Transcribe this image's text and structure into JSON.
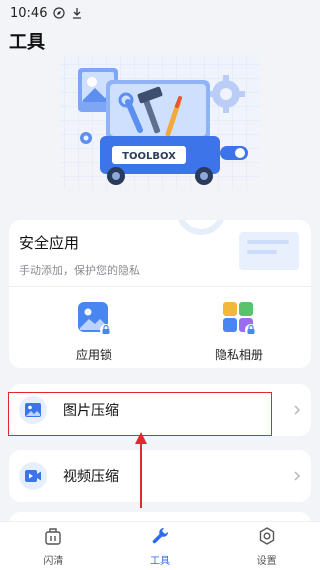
{
  "status_bar": {
    "time": "10:46",
    "icons": [
      "compass-icon",
      "download-icon"
    ]
  },
  "header": {
    "title": "工具"
  },
  "hero": {
    "banner_text": "TOOLBOX",
    "icon": "toolbox-illustration"
  },
  "security_card": {
    "title": "安全应用",
    "subtitle": "手动添加，保护您的隐私",
    "apps": [
      {
        "label": "应用锁",
        "icon": "app-lock-icon"
      },
      {
        "label": "隐私相册",
        "icon": "private-album-icon"
      }
    ]
  },
  "tools": [
    {
      "label": "图片压缩",
      "icon": "image-compress-icon"
    },
    {
      "label": "视频压缩",
      "icon": "video-compress-icon"
    }
  ],
  "tabs": [
    {
      "label": "闪清",
      "icon": "quick-clean-icon",
      "active": false
    },
    {
      "label": "工具",
      "icon": "wrench-icon",
      "active": true
    },
    {
      "label": "设置",
      "icon": "settings-icon",
      "active": false
    }
  ],
  "colors": {
    "accent": "#2f6bf0",
    "background": "#f3f4f8",
    "highlight": "#e0282e"
  }
}
